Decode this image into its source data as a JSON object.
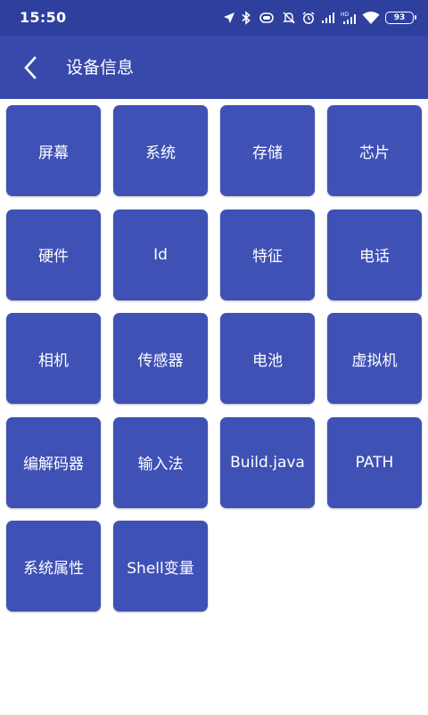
{
  "status_bar": {
    "time": "15:50",
    "battery_level": "93",
    "icons": [
      "location-icon",
      "bluetooth-icon",
      "vibrate-icon",
      "mute-icon",
      "alarm-icon",
      "signal-icon",
      "hd-signal-icon",
      "wifi-icon",
      "battery-icon"
    ]
  },
  "app_bar": {
    "title": "设备信息",
    "back_icon": "back-arrow-icon"
  },
  "colors": {
    "status_bar": "#2f3f9e",
    "app_bar": "#3949ab",
    "tile": "#3f51b5",
    "background": "#ffffff"
  },
  "tiles": [
    {
      "label": "屏幕"
    },
    {
      "label": "系统"
    },
    {
      "label": "存储"
    },
    {
      "label": "芯片"
    },
    {
      "label": "硬件"
    },
    {
      "label": "Id"
    },
    {
      "label": "特征"
    },
    {
      "label": "电话"
    },
    {
      "label": "相机"
    },
    {
      "label": "传感器"
    },
    {
      "label": "电池"
    },
    {
      "label": "虚拟机"
    },
    {
      "label": "编解码器"
    },
    {
      "label": "输入法"
    },
    {
      "label": "Build.java"
    },
    {
      "label": "PATH"
    },
    {
      "label": "系统属性"
    },
    {
      "label": "Shell变量"
    }
  ]
}
